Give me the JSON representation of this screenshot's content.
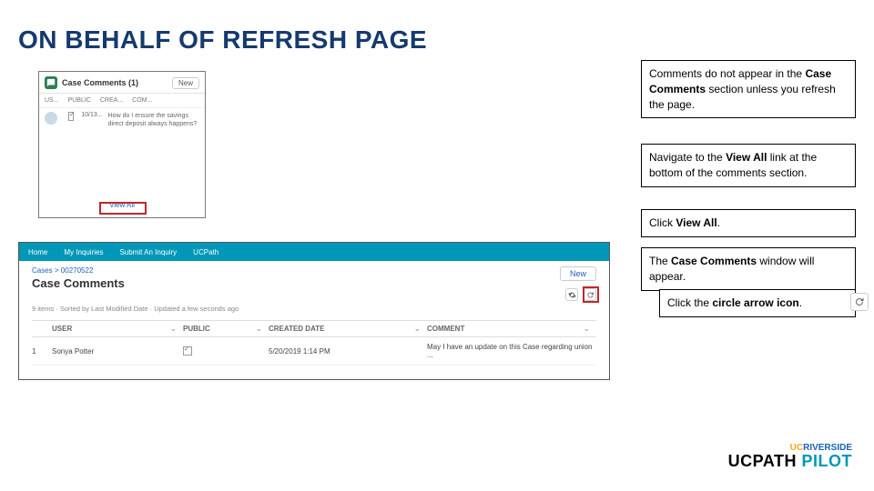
{
  "title": "ON BEHALF OF REFRESH PAGE",
  "shot1": {
    "title": "Case Comments (1)",
    "new": "New",
    "cols": {
      "user": "US...",
      "public": "PUBLIC",
      "created": "CREA...",
      "comment": "COM..."
    },
    "row": {
      "date": "10/13...",
      "comment": "How do I ensure the savings direct deposit always happens?"
    },
    "view_all": "View All"
  },
  "shot2": {
    "nav": {
      "home": "Home",
      "inquiries": "My Inquiries",
      "submit": "Submit An Inquiry",
      "ucpath": "UCPath"
    },
    "breadcrumb": "Cases > 00270522",
    "title": "Case Comments",
    "new": "New",
    "meta": "9 items · Sorted by Last Modified Date · Updated a few seconds ago",
    "thead": {
      "user": "USER",
      "public": "PUBLIC",
      "created": "CREATED DATE",
      "comment": "COMMENT"
    },
    "row": {
      "idx": "1",
      "user": "Sonya Potter",
      "created": "5/20/2019 1:14 PM",
      "comment": "May I have an update on this Case regarding union ..."
    }
  },
  "inst": {
    "i1a": "Comments do not appear in the ",
    "i1b": "Case Comments",
    "i1c": " section unless you refresh the page.",
    "i2a": "Navigate to the ",
    "i2b": "View All",
    "i2c": " link at the bottom of the comments section.",
    "i3a": "Click ",
    "i3b": "View All",
    "i3c": ".",
    "i4a": "The ",
    "i4b": "Case Comments",
    "i4c": " window will appear.",
    "i5a": "Click the ",
    "i5b": "circle arrow icon",
    "i5c": "."
  },
  "logo": {
    "riverside": "RIVERSIDE",
    "brand": "UCPATH",
    "pilot": " PILOT"
  }
}
